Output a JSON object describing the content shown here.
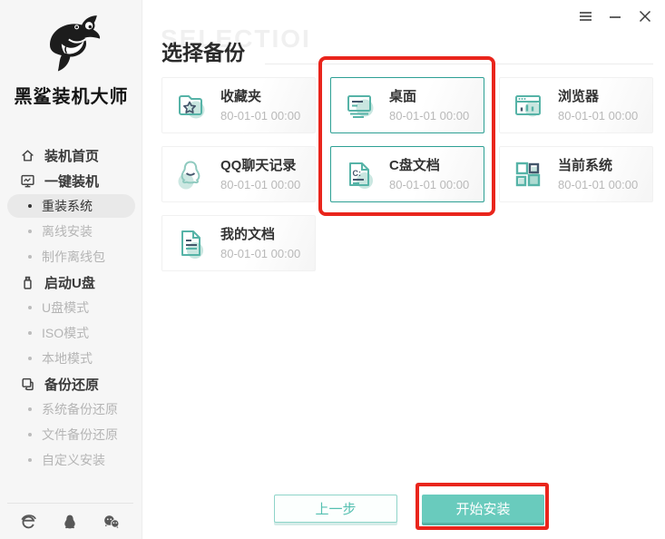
{
  "app": {
    "name": "黑鲨装机大师",
    "logo_icon": "shark-logo-icon"
  },
  "window_controls": {
    "icons": [
      "menu-icon",
      "minimize-icon",
      "close-icon"
    ]
  },
  "sidebar": {
    "items": [
      {
        "label": "装机首页",
        "type": "section",
        "icon": "home-icon",
        "active": false
      },
      {
        "label": "一键装机",
        "type": "section",
        "icon": "monitor-chart-icon",
        "active": false
      },
      {
        "label": "重装系统",
        "type": "sub",
        "active": true
      },
      {
        "label": "离线安装",
        "type": "sub",
        "active": false
      },
      {
        "label": "制作离线包",
        "type": "sub",
        "active": false
      },
      {
        "label": "启动U盘",
        "type": "section",
        "icon": "usb-drive-icon",
        "active": false
      },
      {
        "label": "U盘模式",
        "type": "sub",
        "active": false
      },
      {
        "label": "ISO模式",
        "type": "sub",
        "active": false
      },
      {
        "label": "本地模式",
        "type": "sub",
        "active": false
      },
      {
        "label": "备份还原",
        "type": "section",
        "icon": "backup-restore-icon",
        "active": false
      },
      {
        "label": "系统备份还原",
        "type": "sub",
        "active": false
      },
      {
        "label": "文件备份还原",
        "type": "sub",
        "active": false
      },
      {
        "label": "自定义安装",
        "type": "sub",
        "active": false
      }
    ],
    "footer_icons": [
      "ie-browser-icon",
      "qq-icon",
      "wechat-icon"
    ]
  },
  "main": {
    "title": "选择备份",
    "watermark": "SELECTIOI",
    "cards": [
      {
        "label": "收藏夹",
        "date": "80-01-01 00:00",
        "icon": "folder-star-icon",
        "selected": false
      },
      {
        "label": "桌面",
        "date": "80-01-01 00:00",
        "icon": "desktop-icon",
        "selected": true
      },
      {
        "label": "浏览器",
        "date": "80-01-01 00:00",
        "icon": "browser-icon",
        "selected": false
      },
      {
        "label": "QQ聊天记录",
        "date": "80-01-01 00:00",
        "icon": "qq-chat-icon",
        "selected": false
      },
      {
        "label": "C盘文档",
        "date": "80-01-01 00:00",
        "icon": "c-drive-doc-icon",
        "selected": true,
        "icon_text": "C:"
      },
      {
        "label": "当前系统",
        "date": "80-01-01 00:00",
        "icon": "current-system-icon",
        "selected": false
      },
      {
        "label": "我的文档",
        "date": "80-01-01 00:00",
        "icon": "my-documents-icon",
        "selected": false
      }
    ],
    "buttons": {
      "prev": "上一步",
      "start": "开始安装"
    }
  },
  "colors": {
    "teal": "#69cbbd",
    "teal_stroke": "#56b3a7",
    "teal_light": "#c9e6e0",
    "teal_border_selected": "#2da094",
    "navy": "#44566b",
    "annotation_red": "#e9251c",
    "sidebar_bg": "#f6f6f6",
    "gray_text": "#b5b5b5",
    "dark_text": "#333333"
  }
}
